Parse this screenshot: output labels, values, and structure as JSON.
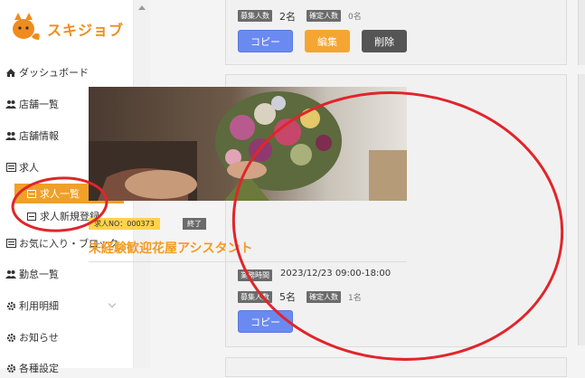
{
  "brand": {
    "name": "スキジョブ"
  },
  "sidebar": {
    "items": [
      {
        "label": "ダッシュボード",
        "icon": "home-icon"
      },
      {
        "label": "店舗一覧",
        "icon": "users-icon"
      },
      {
        "label": "店舗情報",
        "icon": "users-icon"
      },
      {
        "label": "求人",
        "icon": "list-icon"
      },
      {
        "label": "お気に入り・ブロック",
        "icon": "list-icon"
      },
      {
        "label": "勤怠一覧",
        "icon": "users-icon"
      },
      {
        "label": "利用明細",
        "icon": "gear-icon"
      },
      {
        "label": "お知らせ",
        "icon": "gear-icon"
      },
      {
        "label": "各種設定",
        "icon": "gear-icon"
      }
    ],
    "sub_items": [
      {
        "label": "求人一覧",
        "active": true
      },
      {
        "label": "求人新規登録",
        "active": false
      }
    ]
  },
  "top_card": {
    "recruit_label": "募集人数",
    "recruit_value": "2名",
    "confirmed_label": "確定人数",
    "confirmed_value": "0名",
    "copy_label": "コピー",
    "edit_label": "編集",
    "delete_label": "削除"
  },
  "main_card": {
    "job_no": "求人NO：000373",
    "status": "終了",
    "title": "未経験歓迎花屋アシスタント",
    "time_label": "業務時間",
    "time_value": "2023/12/23 09:00-18:00",
    "recruit_label": "募集人数",
    "recruit_value": "5名",
    "confirmed_label": "確定人数",
    "confirmed_value": "1名",
    "copy_label": "コピー"
  },
  "colors": {
    "accent": "#f0a028",
    "copy": "#6b8af0",
    "edit": "#f5a531",
    "delete": "#555555",
    "annotation": "#e0252b"
  }
}
